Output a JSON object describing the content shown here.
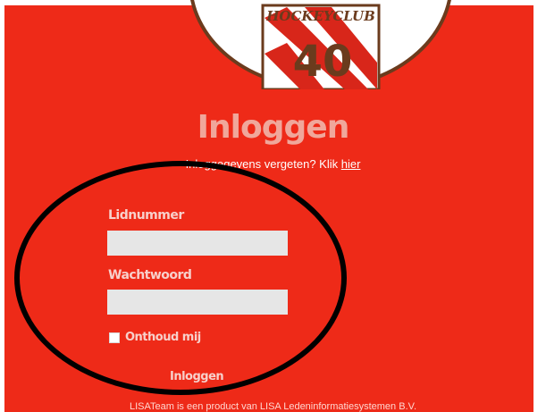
{
  "logo": {
    "name": "HOCKEYCLUB",
    "number": "40",
    "colors": {
      "brand_red": "#ee2a18",
      "shield_red": "#d8261a",
      "shield_white": "#ffffff",
      "frame_brown": "#6b3b1d"
    }
  },
  "header": {
    "title": "Inloggen",
    "forgot_text": "Inloggegevens vergeten? Klik ",
    "forgot_link": "hier"
  },
  "form": {
    "member_label": "Lidnummer",
    "member_value": "",
    "password_label": "Wachtwoord",
    "password_value": "",
    "remember_label": "Onthoud mij",
    "remember_checked": false,
    "submit_label": "Inloggen"
  },
  "footer": {
    "text": "LISATeam is een product van LISA Ledeninformatiesystemen B.V."
  }
}
